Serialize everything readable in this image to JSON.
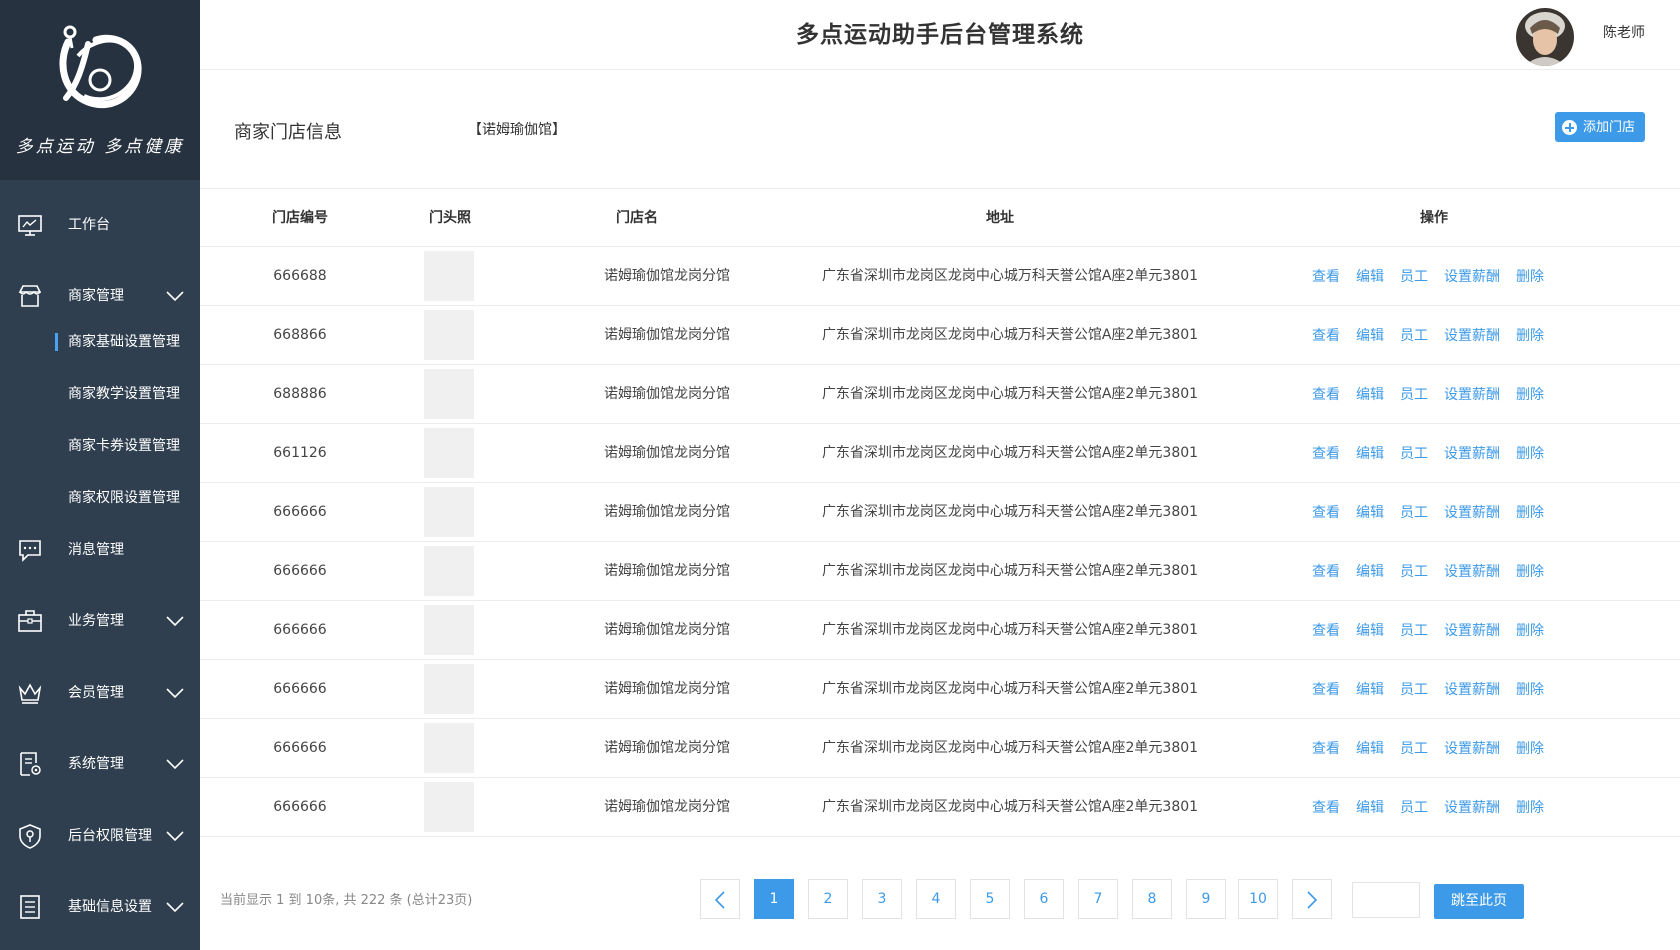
{
  "app": {
    "title": "多点运动助手后台管理系统"
  },
  "brand": {
    "slogan": "多点运动 多点健康",
    "logo_icon": "script-d-snail-logo"
  },
  "user": {
    "name": "陈老师",
    "avatar_icon": "user-avatar"
  },
  "sidebar": {
    "items": [
      {
        "label": "工作台",
        "icon": "monitor-icon",
        "expandable": false
      },
      {
        "label": "商家管理",
        "icon": "store-icon",
        "expandable": true,
        "children": [
          {
            "label": "商家基础设置管理",
            "active": true
          },
          {
            "label": "商家教学设置管理",
            "active": false
          },
          {
            "label": "商家卡券设置管理",
            "active": false
          },
          {
            "label": "商家权限设置管理",
            "active": false
          }
        ]
      },
      {
        "label": "消息管理",
        "icon": "message-icon",
        "expandable": false
      },
      {
        "label": "业务管理",
        "icon": "briefcase-icon",
        "expandable": true
      },
      {
        "label": "会员管理",
        "icon": "crown-icon",
        "expandable": true
      },
      {
        "label": "系统管理",
        "icon": "document-gear-icon",
        "expandable": true
      },
      {
        "label": "后台权限管理",
        "icon": "shield-key-icon",
        "expandable": true
      },
      {
        "label": "基础信息设置",
        "icon": "list-doc-icon",
        "expandable": true
      }
    ]
  },
  "section": {
    "title": "商家门店信息",
    "merchant": "【诺姆瑜伽馆】",
    "add_button": "添加门店"
  },
  "table": {
    "columns": [
      "门店编号",
      "门头照",
      "门店名",
      "地址",
      "操作"
    ],
    "actions": [
      "查看",
      "编辑",
      "员工",
      "设置薪酬",
      "删除"
    ],
    "rows": [
      {
        "id": "666688",
        "name": "诺姆瑜伽馆龙岗分馆",
        "address": "广东省深圳市龙岗区龙岗中心城万科天誉公馆A座2单元3801"
      },
      {
        "id": "668866",
        "name": "诺姆瑜伽馆龙岗分馆",
        "address": "广东省深圳市龙岗区龙岗中心城万科天誉公馆A座2单元3801"
      },
      {
        "id": "688886",
        "name": "诺姆瑜伽馆龙岗分馆",
        "address": "广东省深圳市龙岗区龙岗中心城万科天誉公馆A座2单元3801"
      },
      {
        "id": "661126",
        "name": "诺姆瑜伽馆龙岗分馆",
        "address": "广东省深圳市龙岗区龙岗中心城万科天誉公馆A座2单元3801"
      },
      {
        "id": "666666",
        "name": "诺姆瑜伽馆龙岗分馆",
        "address": "广东省深圳市龙岗区龙岗中心城万科天誉公馆A座2单元3801"
      },
      {
        "id": "666666",
        "name": "诺姆瑜伽馆龙岗分馆",
        "address": "广东省深圳市龙岗区龙岗中心城万科天誉公馆A座2单元3801"
      },
      {
        "id": "666666",
        "name": "诺姆瑜伽馆龙岗分馆",
        "address": "广东省深圳市龙岗区龙岗中心城万科天誉公馆A座2单元3801"
      },
      {
        "id": "666666",
        "name": "诺姆瑜伽馆龙岗分馆",
        "address": "广东省深圳市龙岗区龙岗中心城万科天誉公馆A座2单元3801"
      },
      {
        "id": "666666",
        "name": "诺姆瑜伽馆龙岗分馆",
        "address": "广东省深圳市龙岗区龙岗中心城万科天誉公馆A座2单元3801"
      },
      {
        "id": "666666",
        "name": "诺姆瑜伽馆龙岗分馆",
        "address": "广东省深圳市龙岗区龙岗中心城万科天誉公馆A座2单元3801"
      }
    ]
  },
  "pagination": {
    "info": "当前显示 1 到 10条, 共 222 条 (总计23页)",
    "pages": [
      "1",
      "2",
      "3",
      "4",
      "5",
      "6",
      "7",
      "8",
      "9",
      "10"
    ],
    "current": "1",
    "jump_button": "跳至此页",
    "jump_value": ""
  },
  "colors": {
    "sidebar_bg": "#2f3f4f",
    "logo_bg": "#26323f",
    "accent": "#3d9ae8"
  }
}
